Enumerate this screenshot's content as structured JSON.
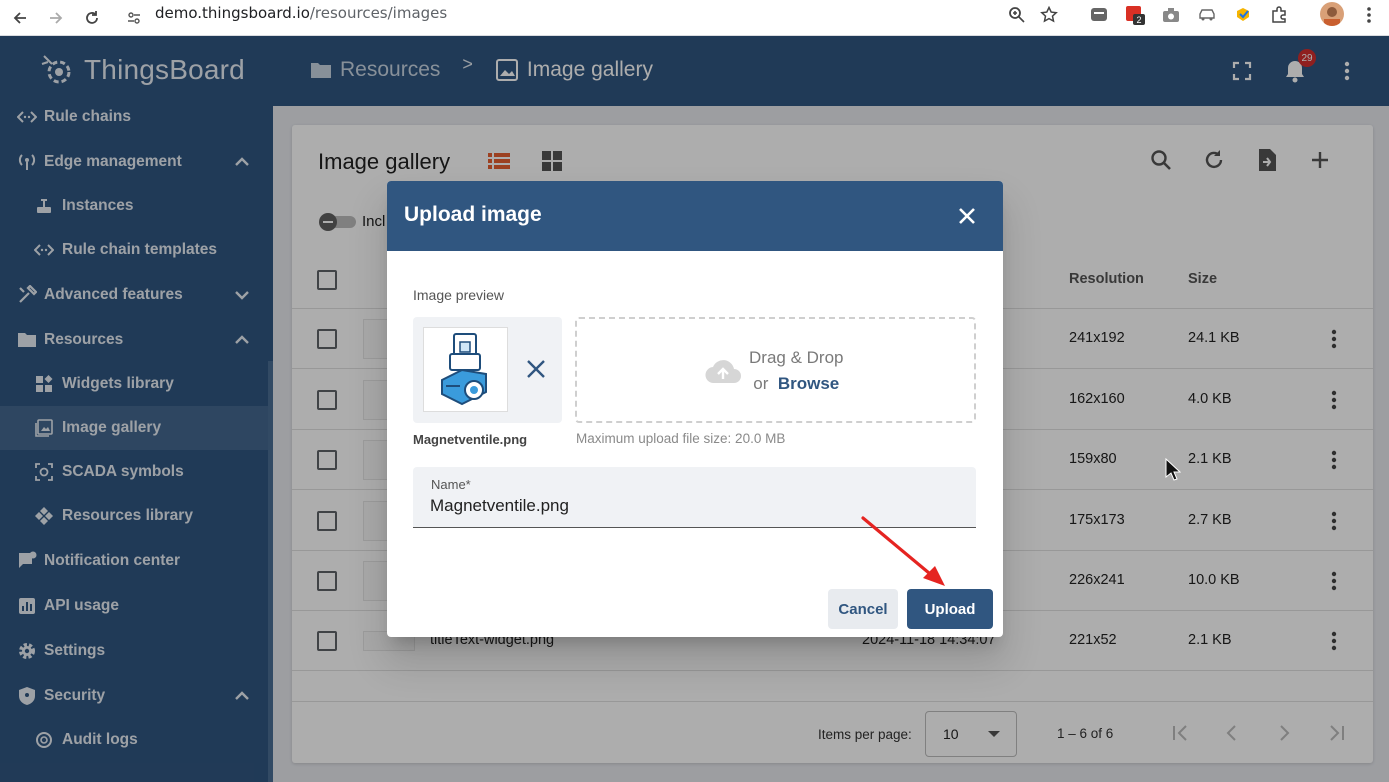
{
  "browser": {
    "url_host": "demo.thingsboard.io",
    "url_path": "/resources/images",
    "ext_badge": "2"
  },
  "header": {
    "logo_text": "ThingsBoard",
    "breadcrumb_parent": "Resources",
    "breadcrumb_separator": ">",
    "breadcrumb_current": "Image gallery",
    "notification_count": "29"
  },
  "sidebar": {
    "items": [
      {
        "label": "Rule chains",
        "icon": "rule-chain-icon"
      },
      {
        "label": "Edge management",
        "icon": "edge-icon"
      },
      {
        "label": "Instances",
        "icon": "router-icon"
      },
      {
        "label": "Rule chain templates",
        "icon": "rule-chain-icon"
      },
      {
        "label": "Advanced features",
        "icon": "tools-icon"
      },
      {
        "label": "Resources",
        "icon": "folder-icon"
      },
      {
        "label": "Widgets library",
        "icon": "widgets-icon"
      },
      {
        "label": "Image gallery",
        "icon": "image-icon"
      },
      {
        "label": "SCADA symbols",
        "icon": "scada-icon"
      },
      {
        "label": "Resources library",
        "icon": "resources-icon"
      },
      {
        "label": "Notification center",
        "icon": "notification-icon"
      },
      {
        "label": "API usage",
        "icon": "chart-icon"
      },
      {
        "label": "Settings",
        "icon": "gear-icon"
      },
      {
        "label": "Security",
        "icon": "shield-icon"
      },
      {
        "label": "Audit logs",
        "icon": "audit-icon"
      }
    ]
  },
  "gallery": {
    "title": "Image gallery",
    "toggle_label": "Incl",
    "columns": {
      "resolution": "Resolution",
      "size": "Size"
    },
    "rows": [
      {
        "name": "",
        "created": "",
        "resolution": "241x192",
        "size": "24.1 KB"
      },
      {
        "name": "",
        "created": "",
        "resolution": "162x160",
        "size": "4.0 KB"
      },
      {
        "name": "",
        "created": "",
        "resolution": "159x80",
        "size": "2.1 KB"
      },
      {
        "name": "",
        "created": "",
        "resolution": "175x173",
        "size": "2.7 KB"
      },
      {
        "name": "",
        "created": "",
        "resolution": "226x241",
        "size": "10.0 KB"
      },
      {
        "name": "titleText-widget.png",
        "created": "2024-11-18 14:34:07",
        "resolution": "221x52",
        "size": "2.1 KB"
      }
    ],
    "footer": {
      "items_per_page_label": "Items per page:",
      "items_per_page_value": "10",
      "range": "1 – 6 of 6"
    }
  },
  "dialog": {
    "title": "Upload image",
    "preview_label": "Image preview",
    "file_name": "Magnetventile.png",
    "dropzone_line1": "Drag & Drop",
    "dropzone_or": "or",
    "dropzone_browse": "Browse",
    "upload_hint": "Maximum upload file size: 20.0 MB",
    "name_label": "Name*",
    "name_value": "Magnetventile.png",
    "cancel_label": "Cancel",
    "upload_label": "Upload"
  },
  "colors": {
    "primary": "#305680",
    "accent_orange": "#e65f32",
    "annotation_red": "#e52421",
    "notification_badge": "#d32f2f"
  }
}
